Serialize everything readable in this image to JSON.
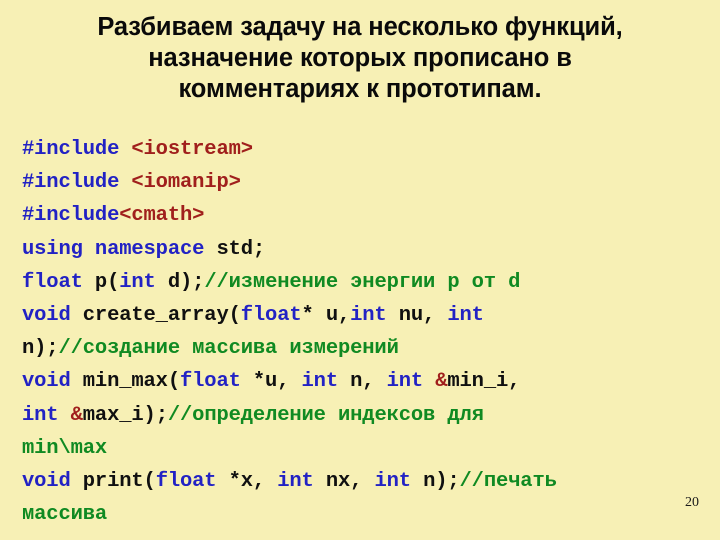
{
  "slide": {
    "background_color": "#f7f0b5",
    "number": "20"
  },
  "title": {
    "lines": [
      "Разбиваем задачу на несколько функций,",
      "назначение которых прописано в",
      "комментариях к прототипам."
    ]
  },
  "code": {
    "language": "cpp",
    "colors": {
      "keyword": "#2222c4",
      "header": "#a01f1c",
      "comment": "#108a22",
      "identifier": "#101010"
    },
    "lines": [
      {
        "index": 0,
        "text": "#include <iostream>",
        "tokens": [
          {
            "t": "#include ",
            "c": "kw"
          },
          {
            "t": "<iostream>",
            "c": "hdr"
          }
        ]
      },
      {
        "index": 1,
        "text": "#include <iomanip>",
        "tokens": [
          {
            "t": "#include ",
            "c": "kw"
          },
          {
            "t": "<iomanip>",
            "c": "hdr"
          }
        ]
      },
      {
        "index": 2,
        "text": "#include<cmath>",
        "tokens": [
          {
            "t": "#include",
            "c": "kw"
          },
          {
            "t": "<cmath>",
            "c": "hdr"
          }
        ]
      },
      {
        "index": 3,
        "text": "using namespace std;",
        "tokens": [
          {
            "t": "using namespace ",
            "c": "kw"
          },
          {
            "t": "std;",
            "c": "id"
          }
        ]
      },
      {
        "index": 4,
        "text": "float p(int d);//изменение энергии p от d",
        "tokens": [
          {
            "t": "float ",
            "c": "kw"
          },
          {
            "t": "p(",
            "c": "id"
          },
          {
            "t": "int",
            "c": "kw"
          },
          {
            "t": " d);",
            "c": "id"
          },
          {
            "t": "//изменение энергии p от d",
            "c": "cmt"
          }
        ]
      },
      {
        "index": 5,
        "text": "void create_array(float* u,int nu, int",
        "tokens": [
          {
            "t": "void ",
            "c": "kw"
          },
          {
            "t": "create_array(",
            "c": "id"
          },
          {
            "t": "float",
            "c": "kw"
          },
          {
            "t": "* u,",
            "c": "id"
          },
          {
            "t": "int",
            "c": "kw"
          },
          {
            "t": " nu, ",
            "c": "id"
          },
          {
            "t": "int",
            "c": "kw"
          }
        ]
      },
      {
        "index": 6,
        "text": "n);//создание массива измерений",
        "tokens": [
          {
            "t": "n);",
            "c": "id"
          },
          {
            "t": "//создание массива измерений",
            "c": "cmt"
          }
        ]
      },
      {
        "index": 7,
        "text": "void min_max(float *u, int n, int &min_i,",
        "tokens": [
          {
            "t": "void ",
            "c": "kw"
          },
          {
            "t": "min_max(",
            "c": "id"
          },
          {
            "t": "float",
            "c": "kw"
          },
          {
            "t": " *u, ",
            "c": "id"
          },
          {
            "t": "int",
            "c": "kw"
          },
          {
            "t": " n, ",
            "c": "id"
          },
          {
            "t": "int",
            "c": "kw"
          },
          {
            "t": " ",
            "c": "id"
          },
          {
            "t": "&",
            "c": "hdr"
          },
          {
            "t": "min_i,",
            "c": "id"
          }
        ]
      },
      {
        "index": 8,
        "text": "int &max_i);//определение индексов для",
        "tokens": [
          {
            "t": "int",
            "c": "kw"
          },
          {
            "t": " ",
            "c": "id"
          },
          {
            "t": "&",
            "c": "hdr"
          },
          {
            "t": "max_i);",
            "c": "id"
          },
          {
            "t": "//определение индексов для",
            "c": "cmt"
          }
        ]
      },
      {
        "index": 9,
        "text": "min\\max",
        "tokens": [
          {
            "t": "min\\max",
            "c": "cmt"
          }
        ]
      },
      {
        "index": 10,
        "text": "void print(float *x, int nx, int n);//печать",
        "tokens": [
          {
            "t": "void ",
            "c": "kw"
          },
          {
            "t": "print(",
            "c": "id"
          },
          {
            "t": "float",
            "c": "kw"
          },
          {
            "t": " *x, ",
            "c": "id"
          },
          {
            "t": "int",
            "c": "kw"
          },
          {
            "t": " nx, ",
            "c": "id"
          },
          {
            "t": "int",
            "c": "kw"
          },
          {
            "t": " n);",
            "c": "id"
          },
          {
            "t": "//печать",
            "c": "cmt"
          }
        ]
      },
      {
        "index": 11,
        "text": "массива",
        "tokens": [
          {
            "t": "массива",
            "c": "cmt"
          }
        ]
      }
    ]
  }
}
